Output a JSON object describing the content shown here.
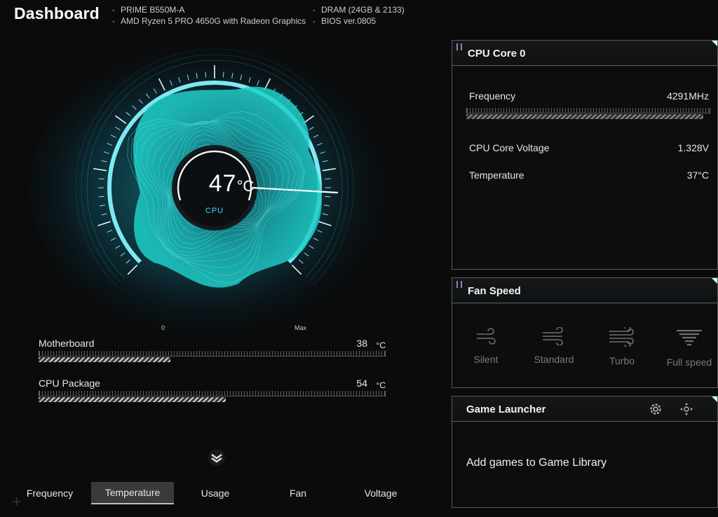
{
  "header": {
    "title": "Dashboard",
    "motherboard": "PRIME B550M-A",
    "cpu": "AMD Ryzen 5 PRO 4650G with Radeon Graphics",
    "dram": "DRAM (24GB & 2133)",
    "bios": "BIOS ver.0805"
  },
  "gauge": {
    "value": "47",
    "unit": "°C",
    "label": "CPU",
    "min_label": "0",
    "max_label": "Max",
    "accent": "#3fd6ff"
  },
  "sensors": [
    {
      "name": "Motherboard",
      "value": "38",
      "unit": "°C",
      "level": 0.38
    },
    {
      "name": "CPU Package",
      "value": "54",
      "unit": "°C",
      "level": 0.54
    }
  ],
  "tabs": [
    "Frequency",
    "Temperature",
    "Usage",
    "Fan",
    "Voltage"
  ],
  "active_tab": "Temperature",
  "cpu_panel": {
    "title": "CPU Core 0",
    "frequency_label": "Frequency",
    "frequency_value": "4291MHz",
    "frequency_level": 0.97,
    "voltage_label": "CPU Core Voltage",
    "voltage_value": "1.328V",
    "temperature_label": "Temperature",
    "temperature_value": "37°C"
  },
  "fan_panel": {
    "title": "Fan Speed",
    "modes": [
      {
        "label": "Silent",
        "icon": "wind-silent-icon"
      },
      {
        "label": "Standard",
        "icon": "wind-standard-icon"
      },
      {
        "label": "Turbo",
        "icon": "wind-turbo-icon"
      },
      {
        "label": "Full speed",
        "icon": "wind-full-icon"
      }
    ]
  },
  "game_panel": {
    "title": "Game Launcher",
    "message": "Add games to Game Library"
  }
}
